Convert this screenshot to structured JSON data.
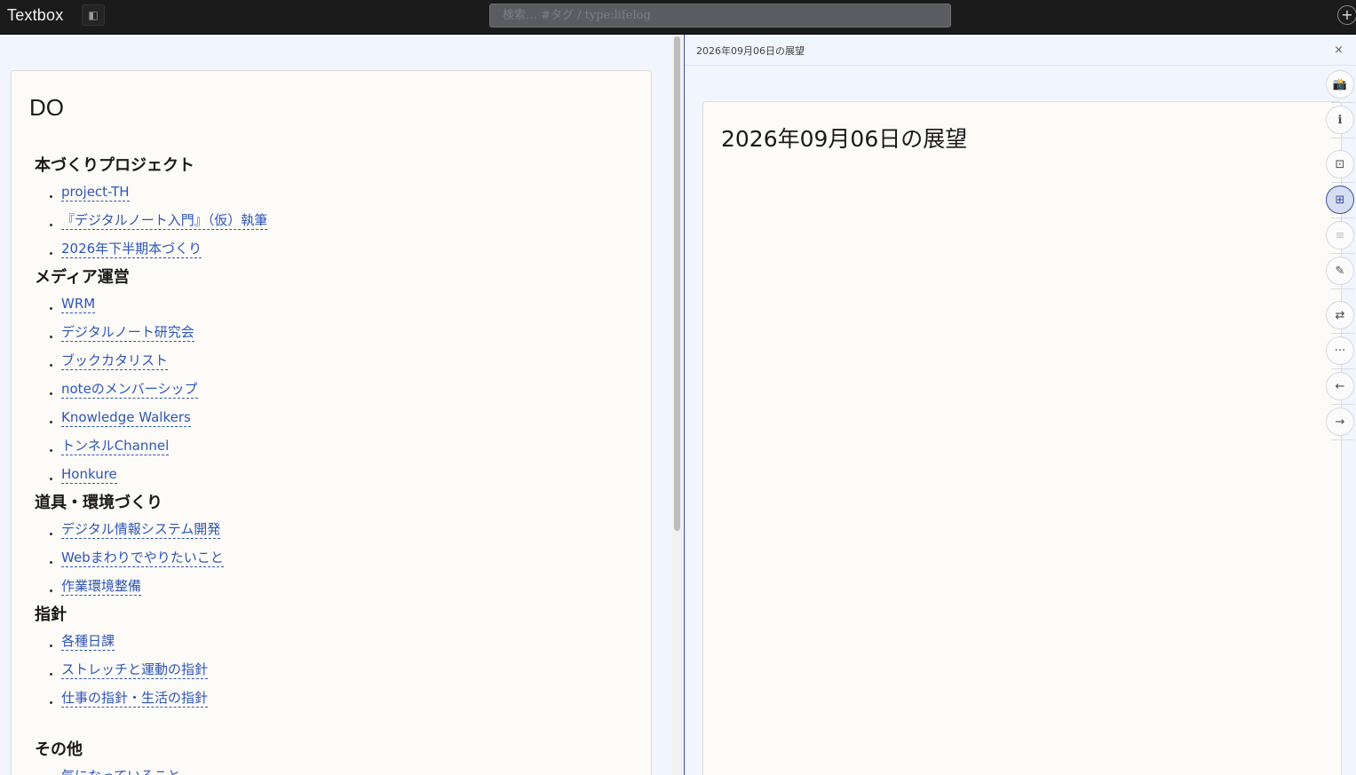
{
  "app": {
    "title": "Textbox",
    "search_placeholder": "検索… #タグ / type:lifelog",
    "add_label": "+",
    "sidebar_toggle_label": "◧"
  },
  "left": {
    "title": "DO",
    "sections": [
      {
        "heading": "本づくりプロジェクト",
        "links": [
          "project-TH",
          "『デジタルノート入門』（仮）執筆",
          "2026年下半期本づくり"
        ]
      },
      {
        "heading": "メディア運営",
        "links": [
          "WRM",
          "デジタルノート研究会",
          "ブックカタリスト",
          "noteのメンバーシップ",
          "Knowledge Walkers",
          "トンネルChannel",
          "Honkure"
        ]
      },
      {
        "heading": "道具・環境づくり",
        "links": [
          "デジタル情報システム開発",
          "Webまわりでやりたいこと",
          "作業環境整備"
        ]
      },
      {
        "heading": "指針",
        "links": [
          "各種日課",
          "ストレッチと運動の指針",
          "仕事の指針・生活の指針"
        ]
      },
      {
        "heading": "その他",
        "links": [
          "気になっていること"
        ]
      }
    ]
  },
  "right": {
    "header_title": "2026年09月06日の展望",
    "close_label": "×",
    "card_title": "2026年09月06日の展望",
    "toolbar": [
      {
        "icon": "camera-icon",
        "glyph": "📸"
      },
      {
        "icon": "info-icon",
        "glyph": "ℹ"
      },
      {
        "icon": "frame-icon",
        "glyph": "⊡"
      },
      {
        "icon": "grid-icon",
        "glyph": "⊞",
        "active": true
      },
      {
        "icon": "list-icon",
        "glyph": "≡",
        "faded": true
      },
      {
        "icon": "edit-icon",
        "glyph": "✎"
      },
      {
        "icon": "swap-icon",
        "glyph": "⇄"
      },
      {
        "icon": "more-icon",
        "glyph": "···"
      },
      {
        "icon": "back-icon",
        "glyph": "←"
      },
      {
        "icon": "forward-icon",
        "glyph": "→"
      }
    ]
  }
}
